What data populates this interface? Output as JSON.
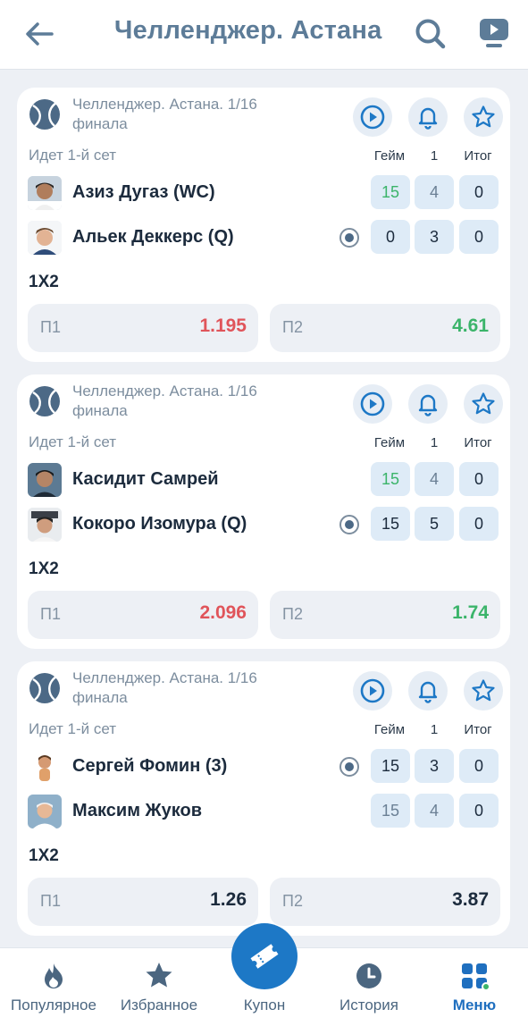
{
  "header": {
    "title": "Челленджер. Астана",
    "back_icon": "arrow-left-icon",
    "search_icon": "search-icon",
    "video_icon": "video-icon"
  },
  "colors": {
    "accent": "#1d78c6",
    "header_text": "#5d7c98",
    "odd_down": "#e0545a",
    "odd_up": "#3bb46a",
    "background": "#edf0f5"
  },
  "matches": [
    {
      "league": "Челленджер. Астана. 1/16 финала",
      "status": "Идет 1-й сет",
      "columns": {
        "game": "Гейм",
        "set1": "1",
        "total": "Итог"
      },
      "players": [
        {
          "name": "Азиз Дугаз (WC)",
          "serving": false,
          "game": "15",
          "set1": "4",
          "total": "0"
        },
        {
          "name": "Альек Деккерс (Q)",
          "serving": true,
          "game": "0",
          "set1": "3",
          "total": "0"
        }
      ],
      "market": "1X2",
      "odds": [
        {
          "label": "П1",
          "value": "1.195",
          "trend": "down"
        },
        {
          "label": "П2",
          "value": "4.61",
          "trend": "up"
        }
      ]
    },
    {
      "league": "Челленджер. Астана. 1/16 финала",
      "status": "Идет 1-й сет",
      "columns": {
        "game": "Гейм",
        "set1": "1",
        "total": "Итог"
      },
      "players": [
        {
          "name": "Касидит Самрей",
          "serving": false,
          "game": "15",
          "set1": "4",
          "total": "0"
        },
        {
          "name": "Кокоро Изомура (Q)",
          "serving": true,
          "game": "15",
          "set1": "5",
          "total": "0"
        }
      ],
      "market": "1X2",
      "odds": [
        {
          "label": "П1",
          "value": "2.096",
          "trend": "down"
        },
        {
          "label": "П2",
          "value": "1.74",
          "trend": "up"
        }
      ]
    },
    {
      "league": "Челленджер. Астана. 1/16 финала",
      "status": "Идет 1-й сет",
      "columns": {
        "game": "Гейм",
        "set1": "1",
        "total": "Итог"
      },
      "players": [
        {
          "name": "Сергей Фомин (3)",
          "serving": true,
          "game": "15",
          "set1": "3",
          "total": "0"
        },
        {
          "name": "Максим Жуков",
          "serving": false,
          "game": "15",
          "set1": "4",
          "total": "0"
        }
      ],
      "market": "1X2",
      "odds": [
        {
          "label": "П1",
          "value": "1.26",
          "trend": "none"
        },
        {
          "label": "П2",
          "value": "3.87",
          "trend": "none"
        }
      ]
    }
  ],
  "bottom_nav": {
    "popular": "Популярное",
    "favorites": "Избранное",
    "coupon": "Купон",
    "history": "История",
    "menu": "Меню"
  }
}
